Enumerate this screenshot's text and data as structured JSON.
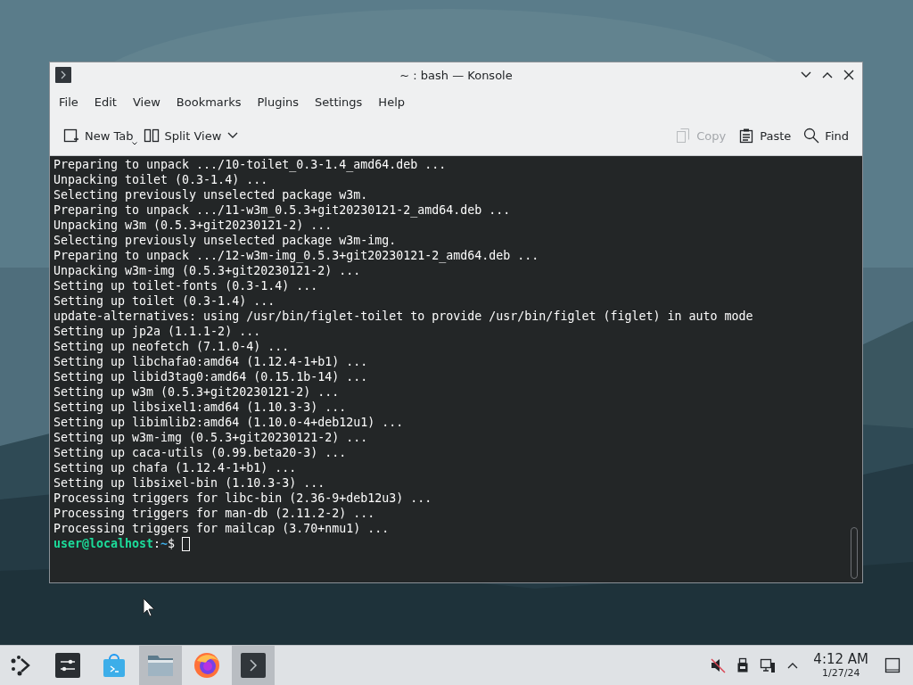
{
  "window": {
    "title": "~ : bash — Konsole"
  },
  "menu": [
    "File",
    "Edit",
    "View",
    "Bookmarks",
    "Plugins",
    "Settings",
    "Help"
  ],
  "toolbar": {
    "left": [
      {
        "kind": "new-tab",
        "label": "New Tab",
        "disabled": false
      },
      {
        "kind": "split-view",
        "label": "Split View",
        "disabled": false
      }
    ],
    "right": [
      {
        "kind": "copy",
        "label": "Copy",
        "disabled": true
      },
      {
        "kind": "paste",
        "label": "Paste",
        "disabled": false
      },
      {
        "kind": "find",
        "label": "Find",
        "disabled": false
      }
    ]
  },
  "terminal": {
    "lines": [
      "Preparing to unpack .../10-toilet_0.3-1.4_amd64.deb ...",
      "Unpacking toilet (0.3-1.4) ...",
      "Selecting previously unselected package w3m.",
      "Preparing to unpack .../11-w3m_0.5.3+git20230121-2_amd64.deb ...",
      "Unpacking w3m (0.5.3+git20230121-2) ...",
      "Selecting previously unselected package w3m-img.",
      "Preparing to unpack .../12-w3m-img_0.5.3+git20230121-2_amd64.deb ...",
      "Unpacking w3m-img (0.5.3+git20230121-2) ...",
      "Setting up toilet-fonts (0.3-1.4) ...",
      "Setting up toilet (0.3-1.4) ...",
      "update-alternatives: using /usr/bin/figlet-toilet to provide /usr/bin/figlet (figlet) in auto mode",
      "Setting up jp2a (1.1.1-2) ...",
      "Setting up neofetch (7.1.0-4) ...",
      "Setting up libchafa0:amd64 (1.12.4-1+b1) ...",
      "Setting up libid3tag0:amd64 (0.15.1b-14) ...",
      "Setting up w3m (0.5.3+git20230121-2) ...",
      "Setting up libsixel1:amd64 (1.10.3-3) ...",
      "Setting up libimlib2:amd64 (1.10.0-4+deb12u1) ...",
      "Setting up w3m-img (0.5.3+git20230121-2) ...",
      "Setting up caca-utils (0.99.beta20-3) ...",
      "Setting up chafa (1.12.4-1+b1) ...",
      "Setting up libsixel-bin (1.10.3-3) ...",
      "Processing triggers for libc-bin (2.36-9+deb12u3) ...",
      "Processing triggers for man-db (2.11.2-2) ...",
      "Processing triggers for mailcap (3.70+nmu1) ..."
    ],
    "prompt": {
      "user": "user@localhost",
      "separator": ":",
      "path": "~",
      "symbol": "$"
    }
  },
  "taskbar": {
    "apps": [
      {
        "kind": "launcher",
        "active": false
      },
      {
        "kind": "settings",
        "active": false
      },
      {
        "kind": "store",
        "active": false
      },
      {
        "kind": "files",
        "active": true
      },
      {
        "kind": "browser",
        "active": false
      },
      {
        "kind": "terminal",
        "active": true
      }
    ],
    "tray": [
      {
        "kind": "muted"
      },
      {
        "kind": "usb"
      },
      {
        "kind": "network"
      },
      {
        "kind": "expand"
      }
    ],
    "time": "4:12 AM",
    "date": "1/27/24"
  }
}
